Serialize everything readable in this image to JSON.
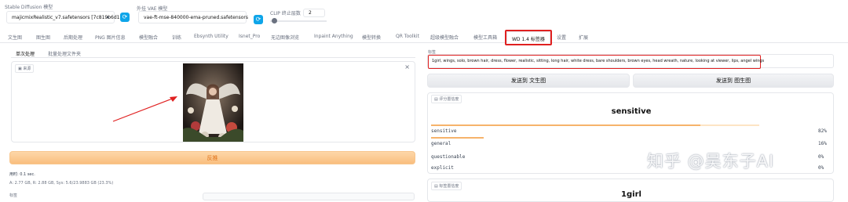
{
  "header": {
    "sd_model_label": "Stable Diffusion 模型",
    "sd_model_value": "majicmixRealistic_v7.safetensors [7c819b6d13]",
    "vae_label": "外挂 VAE 模型",
    "vae_value": "vae-ft-mse-840000-ema-pruned.safetensors",
    "clip_label": "CLIP 终止层数",
    "clip_value": "2",
    "chevron": "▾",
    "refresh_glyph": "⟳"
  },
  "tabs": [
    {
      "label": "文生图"
    },
    {
      "label": "图生图"
    },
    {
      "label": "后期处理"
    },
    {
      "label": "PNG 图片信息"
    },
    {
      "label": "模型融合"
    },
    {
      "label": "训练"
    },
    {
      "label": "Ebsynth Utility"
    },
    {
      "label": "Isnet_Pro"
    },
    {
      "label": "无边图像浏览"
    },
    {
      "label": "Inpaint Anything"
    },
    {
      "label": "模型转换"
    },
    {
      "label": "QR Toolkit"
    },
    {
      "label": "超级模型融合"
    },
    {
      "label": "模型工具箱"
    },
    {
      "label": "WD 1.4 标签器"
    },
    {
      "label": "设置"
    },
    {
      "label": "扩展"
    }
  ],
  "left": {
    "subtabs": [
      {
        "label": "单次处理"
      },
      {
        "label": "批量处理文件夹"
      }
    ],
    "image_label": "来源",
    "close_glyph": "×",
    "interrogate_button": "反推",
    "time_text": "用时: 0.1 sec.",
    "memory_text": "A: 2.77 GB, R: 2.88 GB, Sys: 5.6/23.9883 GB (23.3%)",
    "cut_label": "标签"
  },
  "right": {
    "tags_label": "标签",
    "tags_text": "1girl, wings, solo, brown hair, dress, flower, realistic, sitting, long hair, white dress, bare shoulders, brown eyes, head wreath, nature, looking at viewer, lips, angel wings",
    "send_txt2img": "发送到 文生图",
    "send_img2img": "发送到 图生图",
    "rating_chip": "评分置信度",
    "rating_title": "sensitive",
    "tags_chip": "标签置信度",
    "bottom_title": "1girl"
  },
  "ratings": [
    {
      "name": "sensitive",
      "pct": "82%",
      "value": 0.82
    },
    {
      "name": "general",
      "pct": "16%",
      "value": 0.16
    },
    {
      "name": "questionable",
      "pct": "0%",
      "value": 0.0
    },
    {
      "name": "explicit",
      "pct": "0%",
      "value": 0.0
    }
  ],
  "watermark": "知乎 @吴东子AI",
  "colors": {
    "accent": "#f6b36b",
    "highlight": "#e02020",
    "refresh": "#0ea5e9"
  }
}
